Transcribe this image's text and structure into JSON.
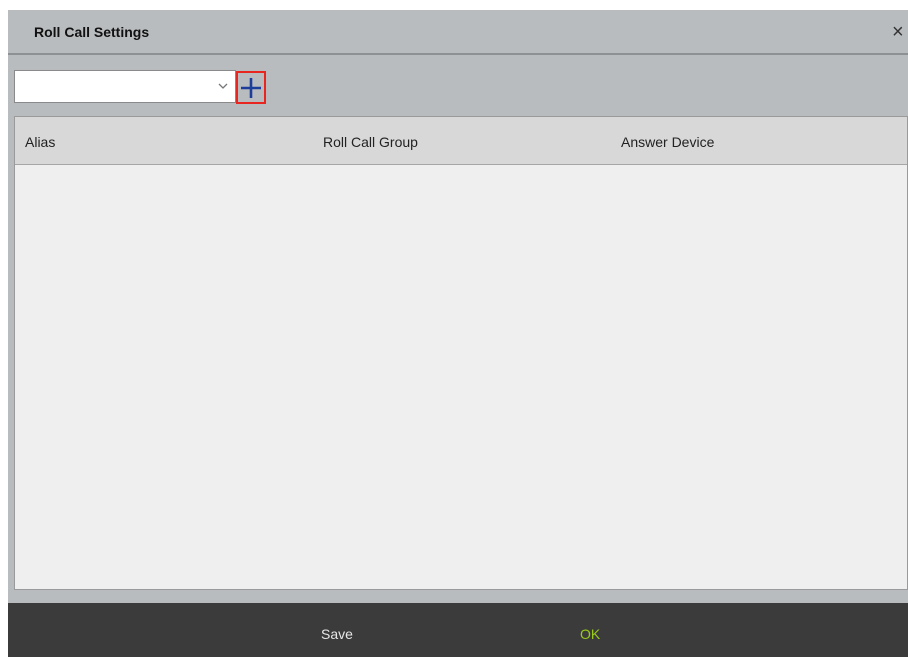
{
  "dialog": {
    "title": "Roll Call Settings",
    "close_glyph": "×"
  },
  "toolbar": {
    "select_value": "",
    "chevron_icon": "chevron-down-icon",
    "add_icon": "plus-icon",
    "add_icon_color": "#1c3e9a",
    "add_highlight_color": "#e8261f"
  },
  "table": {
    "columns": [
      "Alias",
      "Roll Call Group",
      "Answer Device"
    ],
    "rows": []
  },
  "footer": {
    "save_label": "Save",
    "ok_label": "OK",
    "ok_color": "#9acd1b"
  }
}
